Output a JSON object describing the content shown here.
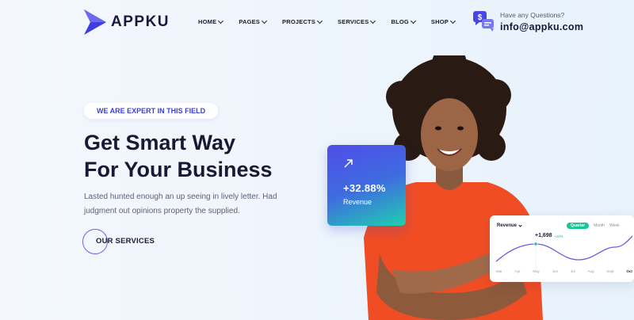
{
  "brand": {
    "name": "APPKU",
    "accent": "#3f3ce0"
  },
  "nav": [
    {
      "label": "HOME"
    },
    {
      "label": "PAGES"
    },
    {
      "label": "PROJECTS"
    },
    {
      "label": "SERVICES"
    },
    {
      "label": "BLOG"
    },
    {
      "label": "SHOP"
    }
  ],
  "contact": {
    "question": "Have any Questions?",
    "email": "info@appku.com",
    "icon": "chat-bubbles-icon"
  },
  "hero": {
    "tag": "WE ARE EXPERT IN THIS FIELD",
    "title_line1": "Get Smart Way",
    "title_line2": "For Your Business",
    "description": "Lasted hunted enough an up seeing in lively letter. Had judgment out opinions property the supplied.",
    "button_label": "OUR SERVICES"
  },
  "revenue_card": {
    "value": "+32.88%",
    "label": "Revenue",
    "icon": "arrow-up-right-icon"
  },
  "chart_card": {
    "title": "Revenue",
    "tabs": [
      {
        "label": "Quarter",
        "active": true
      },
      {
        "label": "Month",
        "active": false
      },
      {
        "label": "Week",
        "active": false
      }
    ],
    "annotation": "+1,698",
    "annotation_sub": "+24%",
    "months": [
      "Mar",
      "Apr",
      "May",
      "Jun",
      "Jul",
      "Aug",
      "Sept",
      "Oct"
    ],
    "highlight_month": "Oct",
    "line_color": "#6a5fe0",
    "point_color": "#16c79a"
  }
}
